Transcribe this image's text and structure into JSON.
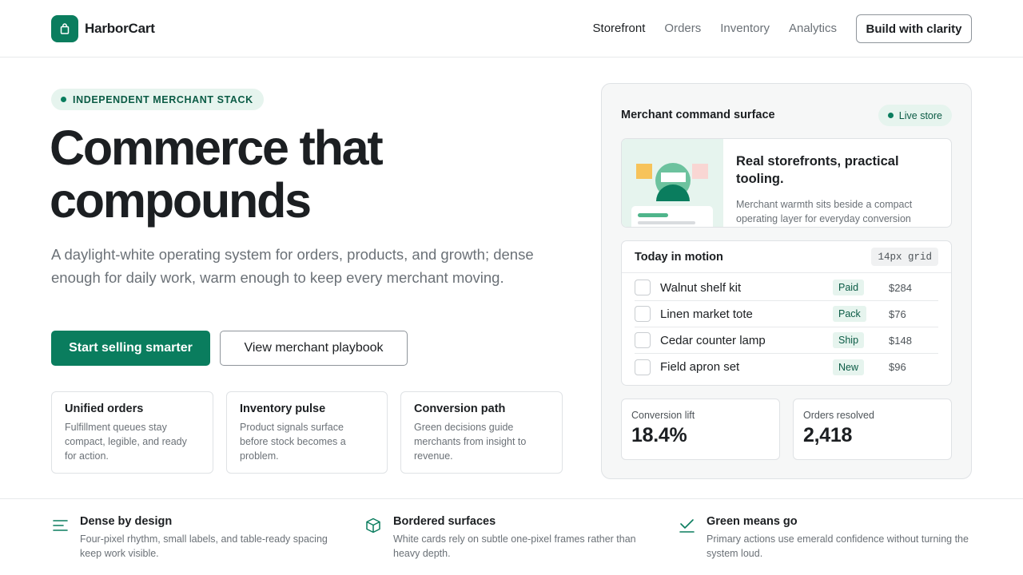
{
  "brand": {
    "name": "HarborCart",
    "accent": "#0a7d5e"
  },
  "nav": {
    "items": [
      "Storefront",
      "Orders",
      "Inventory",
      "Analytics"
    ],
    "active": "Storefront",
    "cta_label": "Build with clarity"
  },
  "hero": {
    "eyebrow": "INDEPENDENT MERCHANT STACK",
    "title_line1": "Commerce that",
    "title_line2": "compounds",
    "subtitle": "A daylight-white operating system for orders, products, and growth; dense enough for daily work, warm enough to keep every merchant moving.",
    "primary_cta": "Start selling smarter",
    "secondary_cta": "View merchant playbook"
  },
  "features": [
    {
      "title": "Unified orders",
      "text": "Fulfillment queues stay compact, legible, and ready for action."
    },
    {
      "title": "Inventory pulse",
      "text": "Product signals surface before stock becomes a problem."
    },
    {
      "title": "Conversion path",
      "text": "Green decisions guide merchants from insight to revenue."
    }
  ],
  "panel": {
    "title": "Merchant command surface",
    "badge": "Live store",
    "promo": {
      "title": "Real storefronts, practical tooling.",
      "text": "Merchant warmth sits beside a compact operating layer for everyday conversion"
    },
    "orders": {
      "title": "Today in motion",
      "tag": "14px grid",
      "rows": [
        {
          "name": "Walnut shelf kit",
          "status": "Paid",
          "price": "$284"
        },
        {
          "name": "Linen market tote",
          "status": "Pack",
          "price": "$76"
        },
        {
          "name": "Cedar counter lamp",
          "status": "Ship",
          "price": "$148"
        },
        {
          "name": "Field apron set",
          "status": "New",
          "price": "$96"
        }
      ]
    },
    "stats": [
      {
        "label": "Conversion lift",
        "value": "18.4%"
      },
      {
        "label": "Orders resolved",
        "value": "2,418"
      }
    ]
  },
  "principles": [
    {
      "icon": "lines-icon",
      "title": "Dense by design",
      "text": "Four-pixel rhythm, small labels, and table-ready spacing keep work visible."
    },
    {
      "icon": "box-icon",
      "title": "Bordered surfaces",
      "text": "White cards rely on subtle one-pixel frames rather than heavy depth."
    },
    {
      "icon": "check-icon",
      "title": "Green means go",
      "text": "Primary actions use emerald confidence without turning the system loud."
    }
  ]
}
